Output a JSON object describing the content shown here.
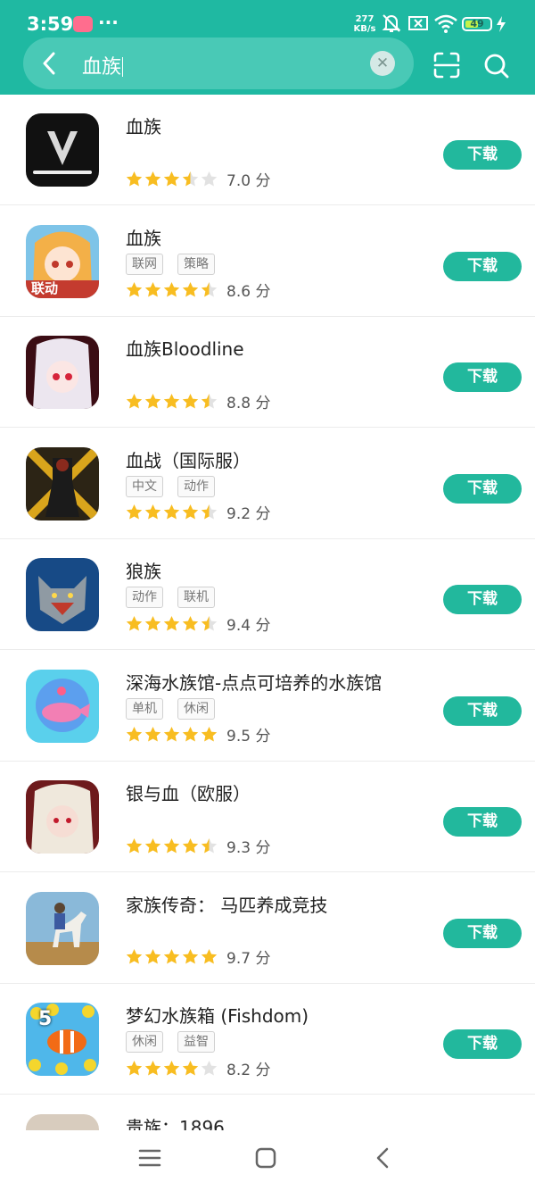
{
  "status_bar": {
    "time": "3:59",
    "dots": "···",
    "net_speed": "277",
    "net_unit": "KB/s",
    "battery_level": "49"
  },
  "search": {
    "query": "血族",
    "back_icon": "chevron-left-icon",
    "clear_icon": "clear-x-icon",
    "scan_icon": "scan-icon",
    "search_icon": "search-icon"
  },
  "colors": {
    "brand": "#1fb9a2",
    "button": "#22b89d",
    "star": "#f8bd21",
    "star_empty": "#e2e2e2"
  },
  "apps": [
    {
      "title": "血族",
      "tags": [],
      "rating": 3.5,
      "score": "7.0 分",
      "button": "下载",
      "icon": "netmarble-v-logo-icon"
    },
    {
      "title": "血族",
      "tags": [
        "联网",
        "策略"
      ],
      "rating": 4.5,
      "score": "8.6 分",
      "button": "下载",
      "icon": "anime-maid-girl-icon",
      "icon_text": "联动"
    },
    {
      "title": "血族Bloodline",
      "tags": [],
      "rating": 4.5,
      "score": "8.8 分",
      "button": "下载",
      "icon": "anime-vampire-girl-icon"
    },
    {
      "title": "血战（国际服）",
      "tags": [
        "中文",
        "动作"
      ],
      "rating": 4.5,
      "score": "9.2 分",
      "button": "下载",
      "icon": "armored-warrior-icon"
    },
    {
      "title": "狼族",
      "tags": [
        "动作",
        "联机"
      ],
      "rating": 4.5,
      "score": "9.4 分",
      "button": "下载",
      "icon": "wolf-icon"
    },
    {
      "title": "深海水族馆-点点可培养的水族馆",
      "tags": [
        "单机",
        "休闲"
      ],
      "rating": 5,
      "score": "9.5 分",
      "button": "下载",
      "icon": "pink-whale-icon"
    },
    {
      "title": "银与血（欧服）",
      "tags": [],
      "rating": 4.5,
      "score": "9.3 分",
      "button": "下载",
      "icon": "elf-vampire-icon"
    },
    {
      "title": "家族传奇： 马匹养成竞技",
      "tags": [],
      "rating": 5,
      "score": "9.7 分",
      "button": "下载",
      "icon": "horse-rider-icon"
    },
    {
      "title": "梦幻水族箱 (Fishdom)",
      "tags": [
        "休闲",
        "益智"
      ],
      "rating": 4,
      "score": "8.2 分",
      "button": "下载",
      "icon": "clownfish-icon",
      "icon_text": "5"
    },
    {
      "title": "贵族：1896",
      "tags": [],
      "rating": 0,
      "score": "",
      "button": "",
      "icon": "noble-portrait-icon"
    }
  ],
  "navbar": {
    "menu_icon": "menu-icon",
    "home_icon": "home-square-icon",
    "back_icon": "back-triangle-icon"
  }
}
